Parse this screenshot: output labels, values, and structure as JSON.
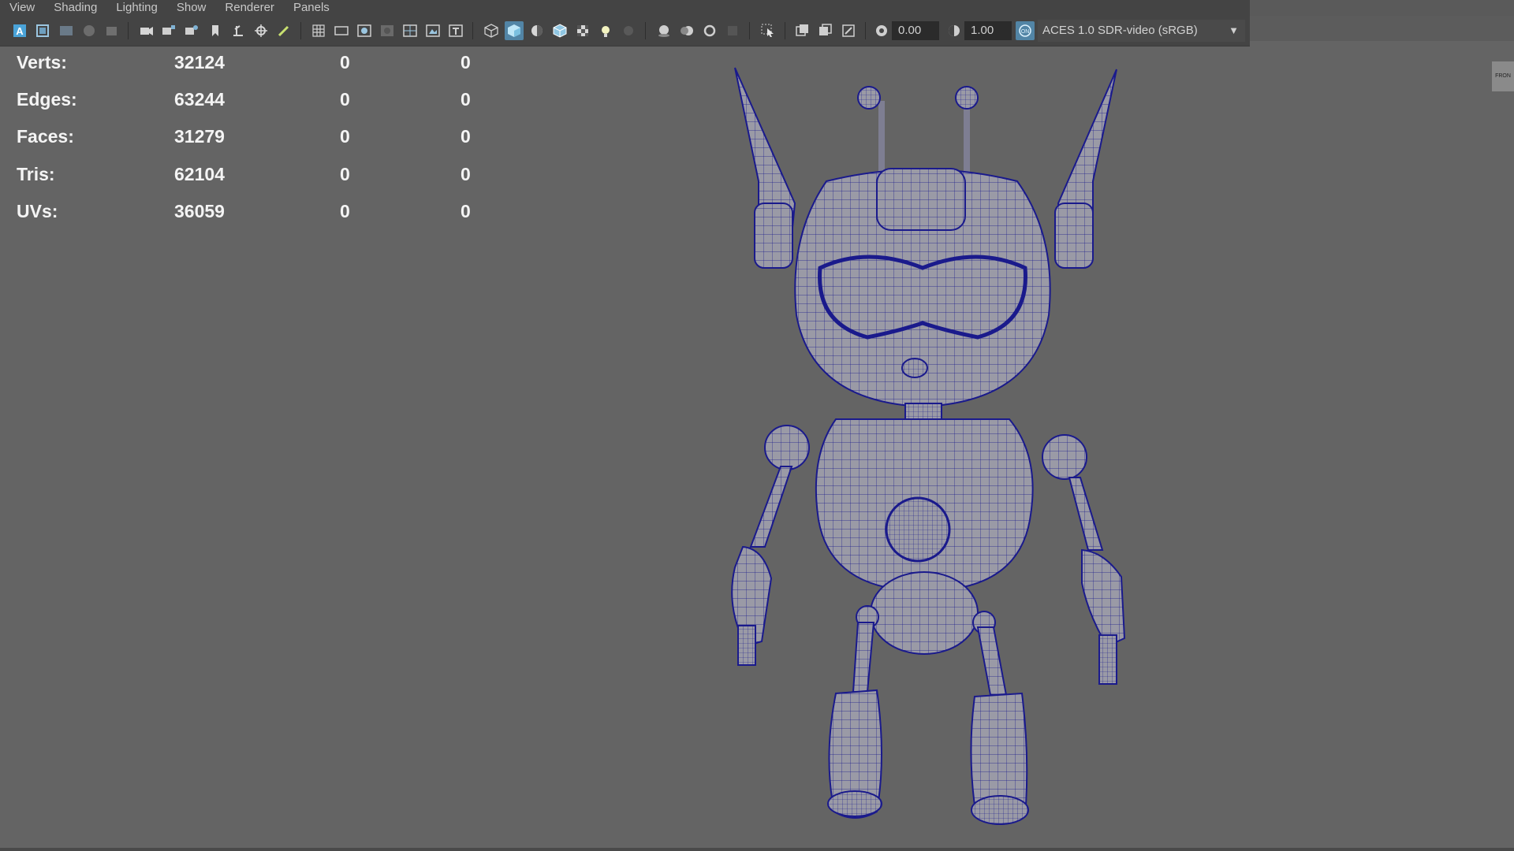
{
  "menu": {
    "items": [
      "View",
      "Shading",
      "Lighting",
      "Show",
      "Renderer",
      "Panels"
    ]
  },
  "toolbar": {
    "icons": [
      {
        "name": "select-camera-icon",
        "active": false
      },
      {
        "name": "camera-attributes-icon",
        "active": false
      },
      {
        "name": "bookmarks-icon",
        "active": false
      },
      {
        "name": "image-plane-icon",
        "active": false
      },
      {
        "name": "2d-pan-zoom-icon",
        "active": false
      },
      {
        "name": "grease-pencil-icon",
        "active": false
      },
      {
        "name": "grid-icon",
        "active": false
      },
      {
        "name": "film-gate-icon",
        "active": false
      },
      {
        "name": "resolution-gate-icon",
        "active": false
      },
      {
        "name": "gate-mask-icon",
        "active": false
      },
      {
        "name": "field-chart-icon",
        "active": false
      },
      {
        "name": "safe-action-icon",
        "active": false
      },
      {
        "name": "safe-title-icon",
        "active": false
      },
      {
        "name": "wireframe-icon",
        "active": false
      },
      {
        "name": "smooth-shade-icon",
        "active": true
      },
      {
        "name": "use-default-material-icon",
        "active": false
      },
      {
        "name": "wireframe-on-shaded-icon",
        "active": false
      },
      {
        "name": "textured-icon",
        "active": false
      },
      {
        "name": "use-all-lights-icon",
        "active": false
      },
      {
        "name": "shadows-icon",
        "active": false
      },
      {
        "name": "screen-space-ao-icon",
        "active": false
      },
      {
        "name": "motion-blur-icon",
        "active": false
      },
      {
        "name": "multisample-aa-icon",
        "active": false
      },
      {
        "name": "depth-of-field-icon",
        "active": false
      },
      {
        "name": "isolate-select-icon",
        "active": false
      },
      {
        "name": "xray-icon",
        "active": false
      },
      {
        "name": "xray-active-components-icon",
        "active": false
      },
      {
        "name": "xray-joints-icon",
        "active": false
      },
      {
        "name": "exposure-icon",
        "active": false
      },
      {
        "name": "gamma-icon",
        "active": false
      },
      {
        "name": "color-management-toggle-icon",
        "active": true
      }
    ],
    "exposure_value": "0.00",
    "gamma_value": "1.00",
    "color_space": "ACES 1.0 SDR-video (sRGB)"
  },
  "hud": {
    "rows": [
      {
        "label": "Verts:",
        "total": "32124",
        "selected": "0",
        "highlighted": "0"
      },
      {
        "label": "Edges:",
        "total": "63244",
        "selected": "0",
        "highlighted": "0"
      },
      {
        "label": "Faces:",
        "total": "31279",
        "selected": "0",
        "highlighted": "0"
      },
      {
        "label": "Tris:",
        "total": "62104",
        "selected": "0",
        "highlighted": "0"
      },
      {
        "label": "UVs:",
        "total": "36059",
        "selected": "0",
        "highlighted": "0"
      }
    ]
  },
  "view_cube_label": "FRON",
  "colors": {
    "viewport_bg": "#646464",
    "wireframe": "#1a1a8c",
    "mesh_shade": "#9a9aa6",
    "active_button": "#5285a6"
  }
}
